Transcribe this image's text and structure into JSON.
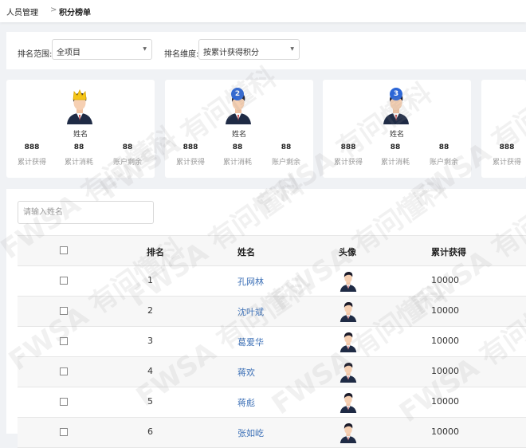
{
  "breadcrumb": {
    "parent": "人员管理",
    "separator": ">",
    "current": "积分榜单"
  },
  "filters": {
    "scope_label": "排名范围:",
    "scope_value": "全项目",
    "dimension_label": "排名维度:",
    "dimension_value": "按累计获得积分"
  },
  "top_cards": [
    {
      "rank_badge": "crown",
      "name": "姓名",
      "stats": [
        {
          "value": "888",
          "label": "累计获得"
        },
        {
          "value": "88",
          "label": "累计消耗"
        },
        {
          "value": "88",
          "label": "账户剩余"
        }
      ]
    },
    {
      "rank_badge": "2",
      "name": "姓名",
      "stats": [
        {
          "value": "888",
          "label": "累计获得"
        },
        {
          "value": "88",
          "label": "累计消耗"
        },
        {
          "value": "88",
          "label": "账户剩余"
        }
      ]
    },
    {
      "rank_badge": "3",
      "name": "姓名",
      "stats": [
        {
          "value": "888",
          "label": "累计获得"
        },
        {
          "value": "88",
          "label": "累计消耗"
        },
        {
          "value": "88",
          "label": "账户剩余"
        }
      ]
    },
    {
      "rank_badge": "",
      "name": "",
      "stats": [
        {
          "value": "888",
          "label": "累计获得"
        }
      ]
    }
  ],
  "search": {
    "placeholder": "请输入姓名"
  },
  "table": {
    "headers": {
      "rank": "排名",
      "name": "姓名",
      "avatar": "头像",
      "earned": "累计获得"
    },
    "rows": [
      {
        "rank": "1",
        "name": "孔网林",
        "earned": "10000"
      },
      {
        "rank": "2",
        "name": "沈叶斌",
        "earned": "10000"
      },
      {
        "rank": "3",
        "name": "葛爱华",
        "earned": "10000"
      },
      {
        "rank": "4",
        "name": "蒋欢",
        "earned": "10000"
      },
      {
        "rank": "5",
        "name": "蒋彪",
        "earned": "10000"
      },
      {
        "rank": "6",
        "name": "张如屹",
        "earned": "10000"
      }
    ]
  },
  "watermark": "FWSA 有问懂科",
  "colors": {
    "accent": "#3b6fb6",
    "badge_blue": "#2c66d6",
    "crown_gold": "#f5c518"
  }
}
